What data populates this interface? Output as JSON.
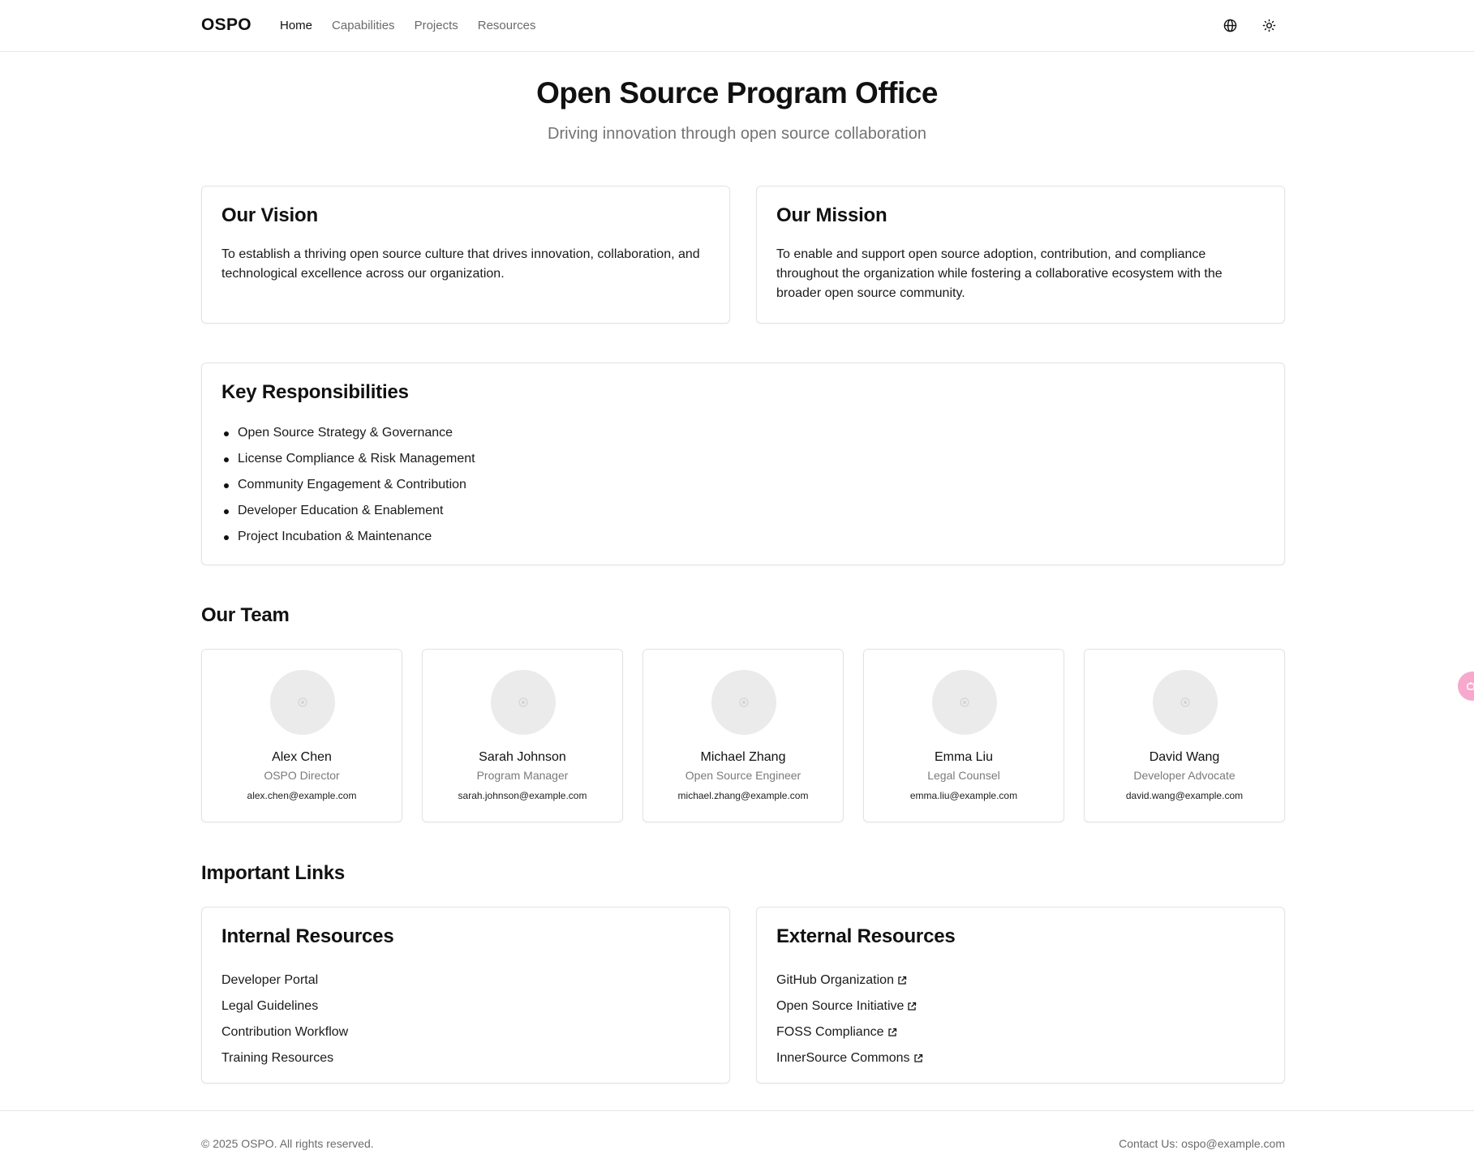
{
  "nav": {
    "brand": "OSPO",
    "items": [
      {
        "label": "Home",
        "active": true
      },
      {
        "label": "Capabilities",
        "active": false
      },
      {
        "label": "Projects",
        "active": false
      },
      {
        "label": "Resources",
        "active": false
      }
    ],
    "icons": [
      "globe-icon",
      "sun-icon"
    ]
  },
  "hero": {
    "title": "Open Source Program Office",
    "subtitle": "Driving innovation through open source collaboration"
  },
  "vision": {
    "title": "Our Vision",
    "text": "To establish a thriving open source culture that drives innovation, collaboration, and technological excellence across our organization."
  },
  "mission": {
    "title": "Our Mission",
    "text": "To enable and support open source adoption, contribution, and compliance throughout the organization while fostering a collaborative ecosystem with the broader open source community."
  },
  "responsibilities": {
    "title": "Key Responsibilities",
    "items": [
      "Open Source Strategy & Governance",
      "License Compliance & Risk Management",
      "Community Engagement & Contribution",
      "Developer Education & Enablement",
      "Project Incubation & Maintenance"
    ]
  },
  "team": {
    "title": "Our Team",
    "members": [
      {
        "name": "Alex Chen",
        "role": "OSPO Director",
        "email": "alex.chen@example.com"
      },
      {
        "name": "Sarah Johnson",
        "role": "Program Manager",
        "email": "sarah.johnson@example.com"
      },
      {
        "name": "Michael Zhang",
        "role": "Open Source Engineer",
        "email": "michael.zhang@example.com"
      },
      {
        "name": "Emma Liu",
        "role": "Legal Counsel",
        "email": "emma.liu@example.com"
      },
      {
        "name": "David Wang",
        "role": "Developer Advocate",
        "email": "david.wang@example.com"
      }
    ]
  },
  "links": {
    "title": "Important Links",
    "internal": {
      "title": "Internal Resources",
      "items": [
        "Developer Portal",
        "Legal Guidelines",
        "Contribution Workflow",
        "Training Resources"
      ]
    },
    "external": {
      "title": "External Resources",
      "items": [
        "GitHub Organization",
        "Open Source Initiative",
        "FOSS Compliance",
        "InnerSource Commons"
      ]
    }
  },
  "footer": {
    "copyright": "© 2025 OSPO. All rights reserved.",
    "contact": "Contact Us: ospo@example.com"
  },
  "colors": {
    "text": "#111111",
    "muted": "#6b6b6b",
    "border": "#e3e3e3",
    "avatar_bg": "#ebebeb",
    "badge": "#f6a9cd"
  }
}
